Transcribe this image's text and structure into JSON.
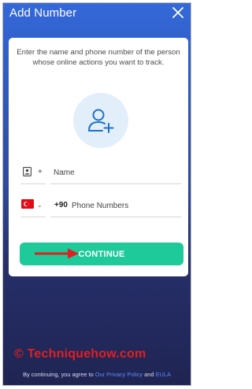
{
  "header": {
    "title": "Add Number",
    "close_icon": "close-icon"
  },
  "card": {
    "instructions": "Enter the name and phone number of the person whose online actions you want to track.",
    "avatar_icon": "add-user-icon"
  },
  "name_field": {
    "icon": "contact-card-icon",
    "prefix": "+",
    "placeholder": "Name"
  },
  "phone_field": {
    "flag_icon": "turkey-flag-icon",
    "dropdown_icon": "chevron-down-icon",
    "country_code": "+90",
    "placeholder": "Phone Numbers"
  },
  "continue_label": "CONTINUE",
  "watermark": "© Techniquehow.com",
  "footer": {
    "prefix": "By continuing, you agree to ",
    "privacy_link": "Our Privacy Policy",
    "conjunction": " and ",
    "eula_link": "EULA"
  },
  "colors": {
    "accent": "#1ec99a",
    "header_blue": "#3568d8",
    "link": "#5b8dff",
    "arrow_red": "#e02020"
  }
}
